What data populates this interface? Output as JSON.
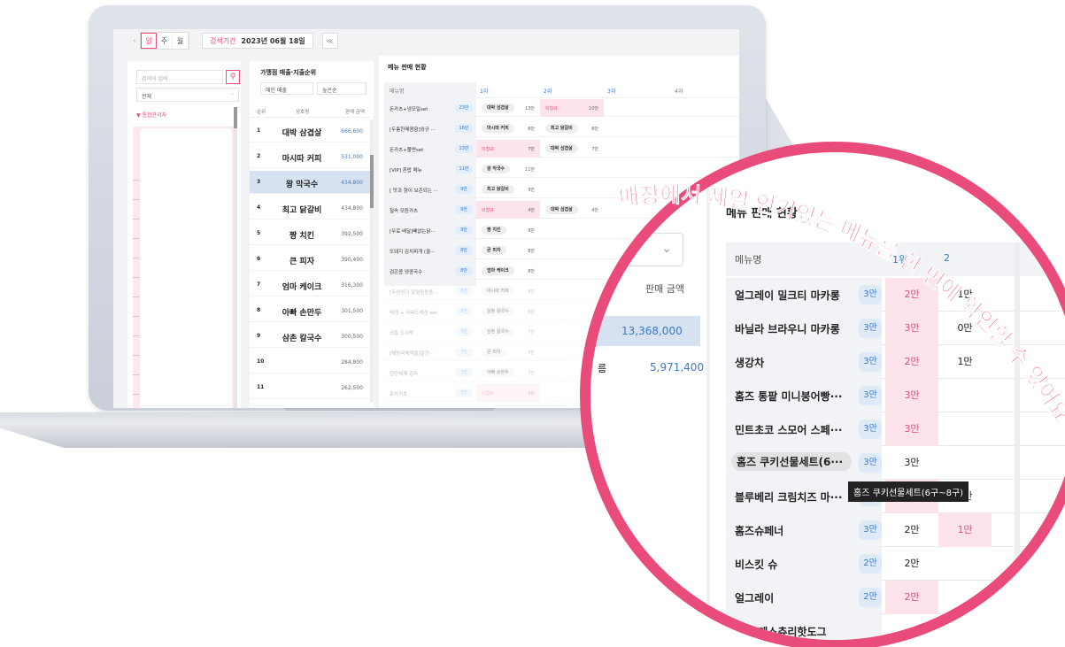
{
  "app": {
    "period_tabs": [
      "일",
      "주",
      "월"
    ],
    "period_label": "검색기간",
    "period_value": "2023년 06월 18일",
    "collapse_label": "≪"
  },
  "side": {
    "search_placeholder": "검색어 입력",
    "select_value": "전체",
    "tree_label": "▼ 통합관리자"
  },
  "ranking": {
    "title": "가맹점 매출·지출순위",
    "sort1": "매인 매출",
    "sort2": "높은순",
    "headers": [
      "순위",
      "상호명",
      "판매 금액"
    ],
    "rows": [
      {
        "rank": "1",
        "name": "대박 삼겹살",
        "value": "666,600",
        "blue": true
      },
      {
        "rank": "2",
        "name": "마시따 커피",
        "value": "531,000",
        "blue": true
      },
      {
        "rank": "3",
        "name": "왕 막국수",
        "value": "434,800",
        "blue": true,
        "selected": true
      },
      {
        "rank": "4",
        "name": "최고 닭갈비",
        "value": "434,800"
      },
      {
        "rank": "5",
        "name": "짱 치킨",
        "value": "392,500"
      },
      {
        "rank": "6",
        "name": "큰 피자",
        "value": "390,400"
      },
      {
        "rank": "7",
        "name": "엄마 케이크",
        "value": "316,300"
      },
      {
        "rank": "8",
        "name": "아빠 손만두",
        "value": "301,500"
      },
      {
        "rank": "9",
        "name": "삼촌 칼국수",
        "value": "300,500"
      },
      {
        "rank": "10",
        "name": "",
        "value": "284,800"
      },
      {
        "rank": "11",
        "name": "",
        "value": "262,500"
      }
    ]
  },
  "board": {
    "title": "메뉴 판매 현황",
    "headers": [
      "메뉴명",
      "1위",
      "2위",
      "3위",
      "4위"
    ],
    "rows": [
      {
        "name": "돈카츠+냉모밀set",
        "count": "23만",
        "c1": "대박 삼겹살",
        "c1a": "13만",
        "c2": "이형규",
        "c2a": "10만",
        "c2pink": true
      },
      {
        "name": "[두툼한매콤함]와규 ···",
        "count": "16만",
        "c1": "마시따 커피",
        "c1a": "8만",
        "c2": "최고 닭갈비",
        "c2a": "8만"
      },
      {
        "name": "돈카츠+쫄면set",
        "count": "13만",
        "c1": "이형규",
        "c1a": "7만",
        "c1pink": true,
        "c2": "대박 삼겹살",
        "c2a": "7만"
      },
      {
        "name": "[VIP] 혼밥 메뉴",
        "count": "11만",
        "c1": "왕 막국수",
        "c1a": "11만"
      },
      {
        "name": "[ 맛과 향이 보존되는 ···",
        "count": "9만",
        "c1": "최고 닭갈비",
        "c1a": "9만"
      },
      {
        "name": "철속 모듬카츠",
        "count": "9만",
        "c1": "이형규",
        "c1a": "4만",
        "c1pink": true,
        "c2": "대박 삼겹살",
        "c2a": "4만"
      },
      {
        "name": "[무료 배달]빼없는닭···",
        "count": "9만",
        "c1": "짱 치킨",
        "c1a": "9만"
      },
      {
        "name": "또돼지 김치찌개 (클···",
        "count": "8만",
        "c1": "큰 피자",
        "c1a": "8만"
      },
      {
        "name": "검은콩 냉콩국수",
        "count": "8만",
        "c1": "엄마 케이크",
        "c1a": "8만"
      },
      {
        "name": "[무산정기 잘얼음동동···",
        "count": "8만",
        "c1": "마시따 커피",
        "c1a": "8만",
        "fade": true
      },
      {
        "name": "떡계 + 사워드레싱 set",
        "count": "8만",
        "c1": "삼촌 칼국수",
        "c1a": "8만",
        "fade": true
      },
      {
        "name": "쇠질 도시락",
        "count": "7만",
        "c1": "삼촌 칼국수",
        "c1a": "7만",
        "fade": true
      },
      {
        "name": "[해장국매력을]일간···",
        "count": "7만",
        "c1": "큰 피자",
        "c1a": "7만",
        "fade": true
      },
      {
        "name": "탄탄체계 감자",
        "count": "7만",
        "c1": "아빠 손만두",
        "c1a": "7만",
        "fade": true
      },
      {
        "name": "토치카츠",
        "count": "7만",
        "c1": "이형규",
        "c1a": "3만",
        "c1pink": true,
        "fade": true
      },
      {
        "name": "매운 김치찜(숲신 감자···",
        "count": "7만",
        "c1": "짱 막국수",
        "c1a": "7만",
        "fade": true
      },
      {
        "name": "성조케스",
        "count": "6만",
        "c1": "이형규",
        "c1a": "3만",
        "c1pink": true,
        "fade": true
      }
    ]
  },
  "magnifier": {
    "title": "메뉴 판매 현황",
    "amount_label": "판매 금액",
    "amount1": "13,368,000",
    "amount2": "5,971,400",
    "label2_suffix": "름",
    "headers": [
      "메뉴명",
      "1위",
      "2"
    ],
    "rows": [
      {
        "name": "얼그레이 밀크티 마카롱",
        "count": "3만",
        "c1": "2만",
        "c1pink": true,
        "c2": "1만"
      },
      {
        "name": "바닐라 브라우니 마카롱",
        "count": "3만",
        "c1": "3만",
        "c1pink": true,
        "c2": "0만"
      },
      {
        "name": "생강차",
        "count": "3만",
        "c1": "2만",
        "c1pink": true,
        "c2": "1만"
      },
      {
        "name": "홈즈 통팥 미니붕어빵···",
        "count": "3만",
        "c1": "3만",
        "c1pink": true,
        "c2": ""
      },
      {
        "name": "민트초코 스모어 스페···",
        "count": "3만",
        "c1": "3만",
        "c1pink": true,
        "c2": ""
      },
      {
        "name": "홈즈 쿠키선물세트(6···",
        "count": "3만",
        "c1": "3만",
        "c2": "",
        "highlight": true
      },
      {
        "name": "블루베리 크림치즈 마···",
        "count": "3만",
        "c1": "2만",
        "c1pink": true,
        "c2": "1만"
      },
      {
        "name": "홈즈슈페너",
        "count": "3만",
        "c1": "2만",
        "c2": "1만",
        "c2pink": true
      },
      {
        "name": "비스킷 슈",
        "count": "2만",
        "c1": "2만",
        "c2": ""
      },
      {
        "name": "얼그레이",
        "count": "2만",
        "c1": "2만",
        "c1pink": true,
        "c2": ""
      },
      {
        "name": "홈즈 페스츄리핫도그",
        "count": "",
        "c1": "",
        "c2": ""
      }
    ],
    "tooltip": "홈즈 쿠키선물세트(6구~8구)"
  },
  "caption": "매장에서 제일 인기있는 메뉴를 한 번에 확인할 수 있어요!",
  "colors": {
    "accent": "#e94b7a",
    "blue": "#3b7ac8",
    "select": "#d6e2ef"
  }
}
